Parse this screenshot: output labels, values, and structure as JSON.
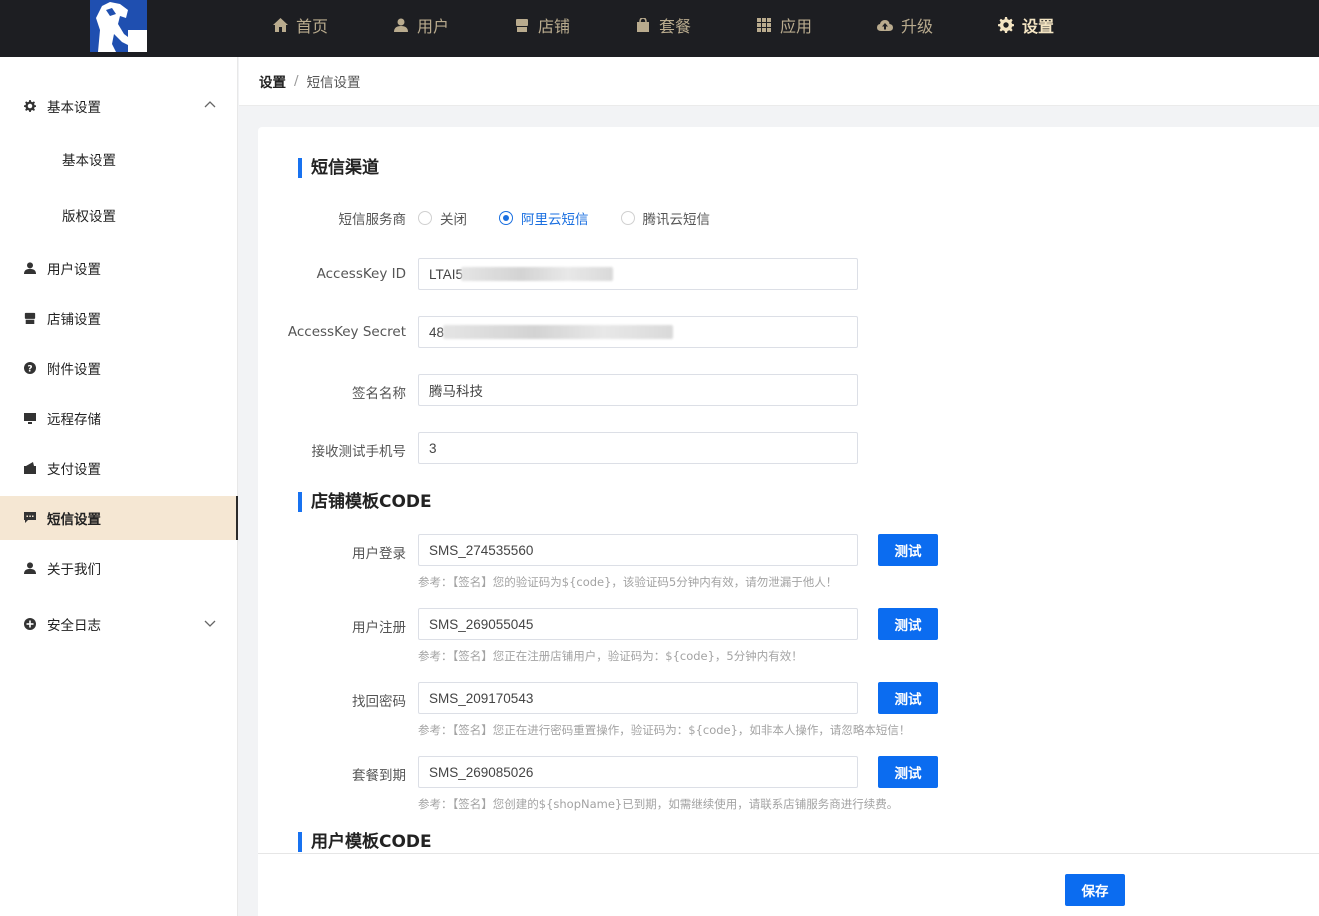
{
  "colors": {
    "topbar": "#1d1e22",
    "nav_text": "#b9ab8e",
    "nav_active": "#f3e4c2",
    "accent": "#0b6cf0",
    "sidebar_active_bg": "#f5e7d3"
  },
  "nav": {
    "items": [
      {
        "label": "首页",
        "icon": "home-icon"
      },
      {
        "label": "用户",
        "icon": "user-icon"
      },
      {
        "label": "店铺",
        "icon": "store-icon"
      },
      {
        "label": "套餐",
        "icon": "bag-icon"
      },
      {
        "label": "应用",
        "icon": "grid-icon"
      },
      {
        "label": "升级",
        "icon": "cloud-upload-icon"
      },
      {
        "label": "设置",
        "icon": "gear-icon",
        "active": true
      }
    ]
  },
  "sidebar": {
    "basic": "基本设置",
    "sub_basic": "基本设置",
    "sub_copyright": "版权设置",
    "user": "用户设置",
    "store": "店铺设置",
    "attachment": "附件设置",
    "remote": "远程存储",
    "payment": "支付设置",
    "sms": "短信设置",
    "about": "关于我们",
    "security": "安全日志"
  },
  "breadcrumb": {
    "root": "设置",
    "sep": "/",
    "current": "短信设置"
  },
  "sms_channel": {
    "title": "短信渠道",
    "provider_label": "短信服务商",
    "providers": [
      "关闭",
      "阿里云短信",
      "腾讯云短信"
    ],
    "selected": "阿里云短信",
    "access_key_id_label": "AccessKey ID",
    "access_key_id_value": "LTAI5",
    "access_key_secret_label": "AccessKey Secret",
    "access_key_secret_value": "48",
    "sign_name_label": "签名名称",
    "sign_name_value": "腾马科技",
    "test_phone_label": "接收测试手机号",
    "test_phone_value": "3"
  },
  "store_template": {
    "title": "店铺模板CODE",
    "test_label": "测试",
    "rows": [
      {
        "label": "用户登录",
        "value": "SMS_274535560",
        "hint": "参考：【签名】您的验证码为${code}，该验证码5分钟内有效，请勿泄漏于他人！"
      },
      {
        "label": "用户注册",
        "value": "SMS_269055045",
        "hint": "参考：【签名】您正在注册店铺用户，验证码为：${code}，5分钟内有效！"
      },
      {
        "label": "找回密码",
        "value": "SMS_209170543",
        "hint": "参考：【签名】您正在进行密码重置操作，验证码为：${code}，如非本人操作，请忽略本短信！"
      },
      {
        "label": "套餐到期",
        "value": "SMS_269085026",
        "hint": "参考：【签名】您创建的${shopName}已到期，如需继续使用，请联系店铺服务商进行续费。"
      }
    ]
  },
  "user_template": {
    "title": "用户模板CODE"
  },
  "footer": {
    "save_label": "保存"
  }
}
